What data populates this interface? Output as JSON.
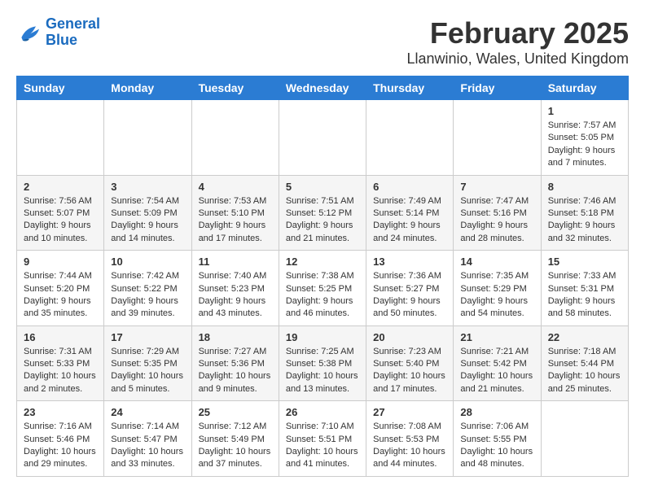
{
  "header": {
    "logo_line1": "General",
    "logo_line2": "Blue",
    "month_year": "February 2025",
    "location": "Llanwinio, Wales, United Kingdom"
  },
  "weekdays": [
    "Sunday",
    "Monday",
    "Tuesday",
    "Wednesday",
    "Thursday",
    "Friday",
    "Saturday"
  ],
  "weeks": [
    [
      {
        "day": "",
        "info": ""
      },
      {
        "day": "",
        "info": ""
      },
      {
        "day": "",
        "info": ""
      },
      {
        "day": "",
        "info": ""
      },
      {
        "day": "",
        "info": ""
      },
      {
        "day": "",
        "info": ""
      },
      {
        "day": "1",
        "info": "Sunrise: 7:57 AM\nSunset: 5:05 PM\nDaylight: 9 hours and 7 minutes."
      }
    ],
    [
      {
        "day": "2",
        "info": "Sunrise: 7:56 AM\nSunset: 5:07 PM\nDaylight: 9 hours and 10 minutes."
      },
      {
        "day": "3",
        "info": "Sunrise: 7:54 AM\nSunset: 5:09 PM\nDaylight: 9 hours and 14 minutes."
      },
      {
        "day": "4",
        "info": "Sunrise: 7:53 AM\nSunset: 5:10 PM\nDaylight: 9 hours and 17 minutes."
      },
      {
        "day": "5",
        "info": "Sunrise: 7:51 AM\nSunset: 5:12 PM\nDaylight: 9 hours and 21 minutes."
      },
      {
        "day": "6",
        "info": "Sunrise: 7:49 AM\nSunset: 5:14 PM\nDaylight: 9 hours and 24 minutes."
      },
      {
        "day": "7",
        "info": "Sunrise: 7:47 AM\nSunset: 5:16 PM\nDaylight: 9 hours and 28 minutes."
      },
      {
        "day": "8",
        "info": "Sunrise: 7:46 AM\nSunset: 5:18 PM\nDaylight: 9 hours and 32 minutes."
      }
    ],
    [
      {
        "day": "9",
        "info": "Sunrise: 7:44 AM\nSunset: 5:20 PM\nDaylight: 9 hours and 35 minutes."
      },
      {
        "day": "10",
        "info": "Sunrise: 7:42 AM\nSunset: 5:22 PM\nDaylight: 9 hours and 39 minutes."
      },
      {
        "day": "11",
        "info": "Sunrise: 7:40 AM\nSunset: 5:23 PM\nDaylight: 9 hours and 43 minutes."
      },
      {
        "day": "12",
        "info": "Sunrise: 7:38 AM\nSunset: 5:25 PM\nDaylight: 9 hours and 46 minutes."
      },
      {
        "day": "13",
        "info": "Sunrise: 7:36 AM\nSunset: 5:27 PM\nDaylight: 9 hours and 50 minutes."
      },
      {
        "day": "14",
        "info": "Sunrise: 7:35 AM\nSunset: 5:29 PM\nDaylight: 9 hours and 54 minutes."
      },
      {
        "day": "15",
        "info": "Sunrise: 7:33 AM\nSunset: 5:31 PM\nDaylight: 9 hours and 58 minutes."
      }
    ],
    [
      {
        "day": "16",
        "info": "Sunrise: 7:31 AM\nSunset: 5:33 PM\nDaylight: 10 hours and 2 minutes."
      },
      {
        "day": "17",
        "info": "Sunrise: 7:29 AM\nSunset: 5:35 PM\nDaylight: 10 hours and 5 minutes."
      },
      {
        "day": "18",
        "info": "Sunrise: 7:27 AM\nSunset: 5:36 PM\nDaylight: 10 hours and 9 minutes."
      },
      {
        "day": "19",
        "info": "Sunrise: 7:25 AM\nSunset: 5:38 PM\nDaylight: 10 hours and 13 minutes."
      },
      {
        "day": "20",
        "info": "Sunrise: 7:23 AM\nSunset: 5:40 PM\nDaylight: 10 hours and 17 minutes."
      },
      {
        "day": "21",
        "info": "Sunrise: 7:21 AM\nSunset: 5:42 PM\nDaylight: 10 hours and 21 minutes."
      },
      {
        "day": "22",
        "info": "Sunrise: 7:18 AM\nSunset: 5:44 PM\nDaylight: 10 hours and 25 minutes."
      }
    ],
    [
      {
        "day": "23",
        "info": "Sunrise: 7:16 AM\nSunset: 5:46 PM\nDaylight: 10 hours and 29 minutes."
      },
      {
        "day": "24",
        "info": "Sunrise: 7:14 AM\nSunset: 5:47 PM\nDaylight: 10 hours and 33 minutes."
      },
      {
        "day": "25",
        "info": "Sunrise: 7:12 AM\nSunset: 5:49 PM\nDaylight: 10 hours and 37 minutes."
      },
      {
        "day": "26",
        "info": "Sunrise: 7:10 AM\nSunset: 5:51 PM\nDaylight: 10 hours and 41 minutes."
      },
      {
        "day": "27",
        "info": "Sunrise: 7:08 AM\nSunset: 5:53 PM\nDaylight: 10 hours and 44 minutes."
      },
      {
        "day": "28",
        "info": "Sunrise: 7:06 AM\nSunset: 5:55 PM\nDaylight: 10 hours and 48 minutes."
      },
      {
        "day": "",
        "info": ""
      }
    ]
  ]
}
